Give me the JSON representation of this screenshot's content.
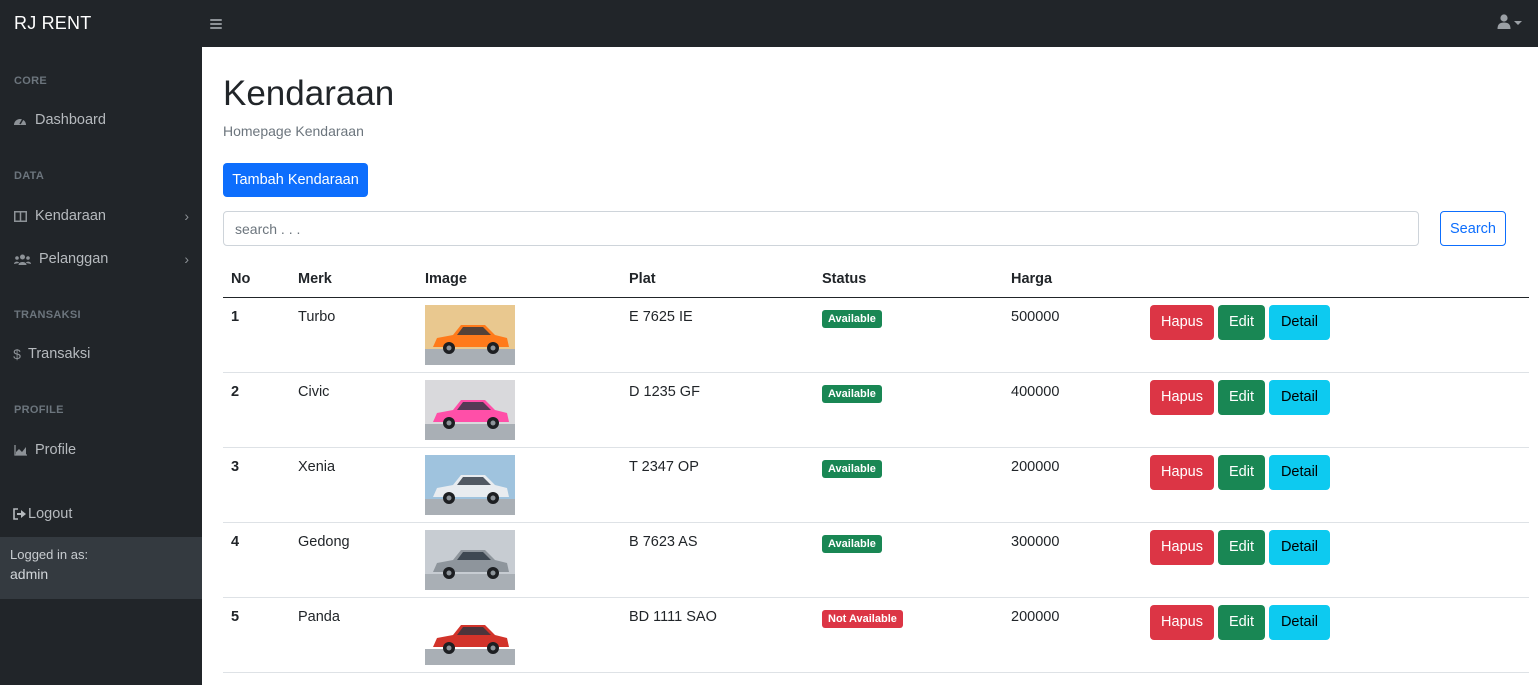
{
  "app": {
    "brand": "RJ RENT"
  },
  "sidebar": {
    "sections": [
      {
        "heading": "CORE",
        "items": [
          {
            "label": "Dashboard",
            "icon": "tachometer-icon"
          }
        ]
      },
      {
        "heading": "DATA",
        "items": [
          {
            "label": "Kendaraan",
            "icon": "columns-icon",
            "expandable": true
          },
          {
            "label": "Pelanggan",
            "icon": "users-icon",
            "expandable": true
          }
        ]
      },
      {
        "heading": "TRANSAKSI",
        "items": [
          {
            "label": "Transaksi",
            "icon": "dollar-icon"
          }
        ]
      },
      {
        "heading": "PROFILE",
        "items": [
          {
            "label": "Profile",
            "icon": "chart-area-icon"
          }
        ]
      }
    ],
    "logout": "Logout",
    "footer": {
      "logged_in_as": "Logged in as:",
      "user": "admin"
    }
  },
  "main": {
    "title": "Kendaraan",
    "subtitle": "Homepage Kendaraan",
    "add_button": "Tambah Kendaraan",
    "search": {
      "placeholder": "search . . .",
      "button": "Search"
    },
    "table": {
      "headers": [
        "No",
        "Merk",
        "Image",
        "Plat",
        "Status",
        "Harga",
        ""
      ],
      "rows": [
        {
          "no": "1",
          "merk": "Turbo",
          "plat": "E 7625 IE",
          "status": "Available",
          "available": true,
          "harga": "500000",
          "car_color": "#ff7a1a"
        },
        {
          "no": "2",
          "merk": "Civic",
          "plat": "D 1235 GF",
          "status": "Available",
          "available": true,
          "harga": "400000",
          "car_color": "#ff4fa8"
        },
        {
          "no": "3",
          "merk": "Xenia",
          "plat": "T 2347 OP",
          "status": "Available",
          "available": true,
          "harga": "200000",
          "car_color": "#e8ecf0"
        },
        {
          "no": "4",
          "merk": "Gedong",
          "plat": "B 7623 AS",
          "status": "Available",
          "available": true,
          "harga": "300000",
          "car_color": "#8e959c"
        },
        {
          "no": "5",
          "merk": "Panda",
          "plat": "BD 1111 SAO",
          "status": "Not Available",
          "available": false,
          "harga": "200000",
          "car_color": "#d2332a"
        }
      ],
      "actions": {
        "delete": "Hapus",
        "edit": "Edit",
        "detail": "Detail"
      }
    }
  },
  "colors": {
    "primary": "#0d6efd",
    "success": "#198754",
    "danger": "#dc3545",
    "info": "#0dcaf0",
    "dark": "#212529"
  }
}
